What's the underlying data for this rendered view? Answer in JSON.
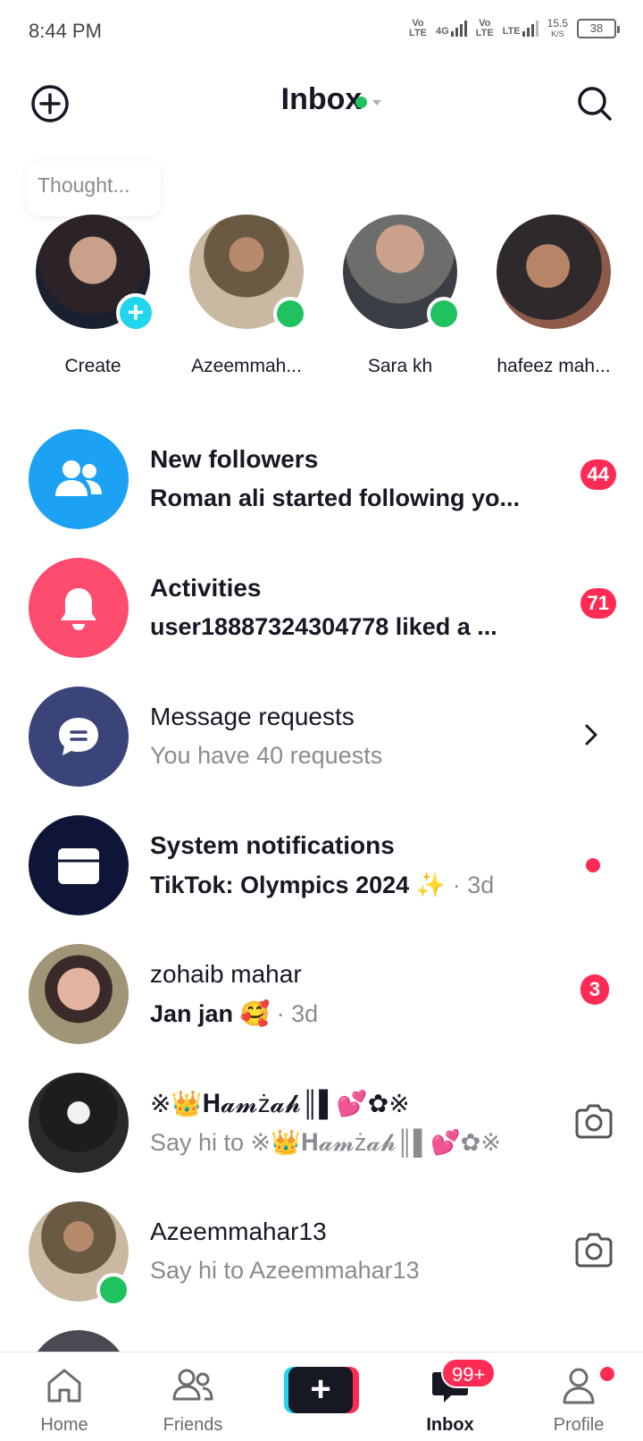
{
  "status_bar": {
    "time": "8:44 PM",
    "net1": "Vo\nLTE",
    "net2": "4G",
    "net3": "Vo\nLTE",
    "net4": "LTE",
    "speed": "15.5",
    "speed_unit": "K/S",
    "battery": "38"
  },
  "header": {
    "title": "Inbox",
    "status_color": "#20c25f"
  },
  "thought": {
    "placeholder": "Thought..."
  },
  "stories": [
    {
      "name": "Create",
      "badge": "plus"
    },
    {
      "name": "Azeemmah...",
      "badge": "online"
    },
    {
      "name": "Sara kh",
      "badge": "online"
    },
    {
      "name": "hafeez mah...",
      "badge": "none"
    }
  ],
  "rows": {
    "new_followers": {
      "title": "New followers",
      "subtitle": "Roman ali started following yo...",
      "count": "44",
      "icon": "people-icon",
      "color": "#1da1f2"
    },
    "activities": {
      "title": "Activities",
      "subtitle": "user18887324304778 liked a ...",
      "count": "71",
      "icon": "bell-icon",
      "color": "#fe4c6e"
    },
    "message_requests": {
      "title": "Message requests",
      "subtitle": "You have 40 requests",
      "icon": "chat-bubble-icon",
      "color": "#3b4479"
    },
    "system": {
      "title": "System notifications",
      "subtitle": "TikTok: Olympics 2024 ✨",
      "time": "· 3d",
      "icon": "inbox-tray-icon",
      "color": "#0f1537"
    },
    "zohaib": {
      "title": "zohaib mahar",
      "subtitle": "Jan jan 🥰",
      "time": "· 3d",
      "count": "3"
    },
    "hamzah": {
      "title": "※👑𝐇𝓪𝓶ż𝓪𝓱║▌💕✿※",
      "subtitle": "Say hi to ※👑𝐇𝓪𝓶ż𝓪𝓱║▌💕✿※"
    },
    "azeem": {
      "title": "Azeemmahar13",
      "subtitle": "Say hi to Azeemmahar13"
    }
  },
  "bottom_nav": {
    "home": "Home",
    "friends": "Friends",
    "inbox": "Inbox",
    "inbox_badge": "99+",
    "profile": "Profile"
  }
}
